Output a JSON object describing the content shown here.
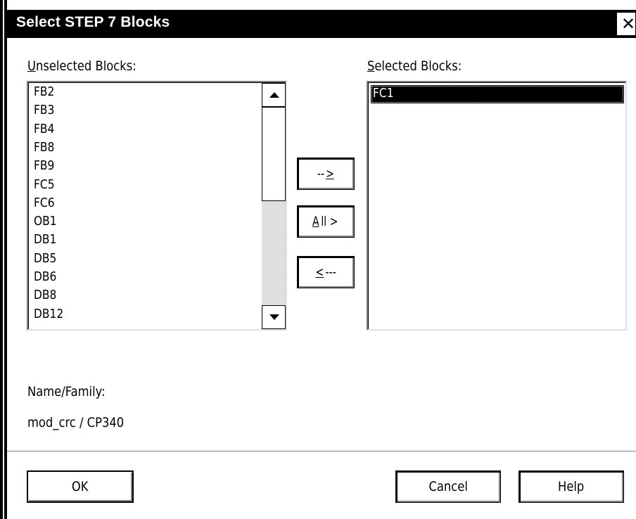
{
  "dialog": {
    "title": "Select STEP 7 Blocks",
    "close_glyph": "✕",
    "unselected_label_accel": "U",
    "unselected_label_rest": "nselected Blocks:",
    "selected_label_accel": "S",
    "selected_label_rest": "elected Blocks:",
    "unselected_items": [
      "FB2",
      "FB3",
      "FB4",
      "FB8",
      "FB9",
      "FC5",
      "FC6",
      "OB1",
      "DB1",
      "DB5",
      "DB6",
      "DB8",
      "DB12"
    ],
    "selected_items": [
      "FC1"
    ],
    "move_right_pre": "--",
    "move_right_accel": ">",
    "all_accel": "A",
    "all_rest": "ll >",
    "move_left_accel": "<",
    "move_left_rest": "---",
    "name_family_label": "Name/Family:",
    "name_family_value": "mod_crc / CP340",
    "ok_label": "OK",
    "cancel_label": "Cancel",
    "help_label": "Help"
  },
  "icons": {
    "close": "close-icon",
    "scroll_up": "scroll-up-arrow-icon",
    "scroll_down": "scroll-down-arrow-icon"
  },
  "colors": {
    "titlebar": "#000000",
    "background": "#ffffff",
    "selection": "#000000",
    "track_pattern": "#c0c0c0"
  }
}
